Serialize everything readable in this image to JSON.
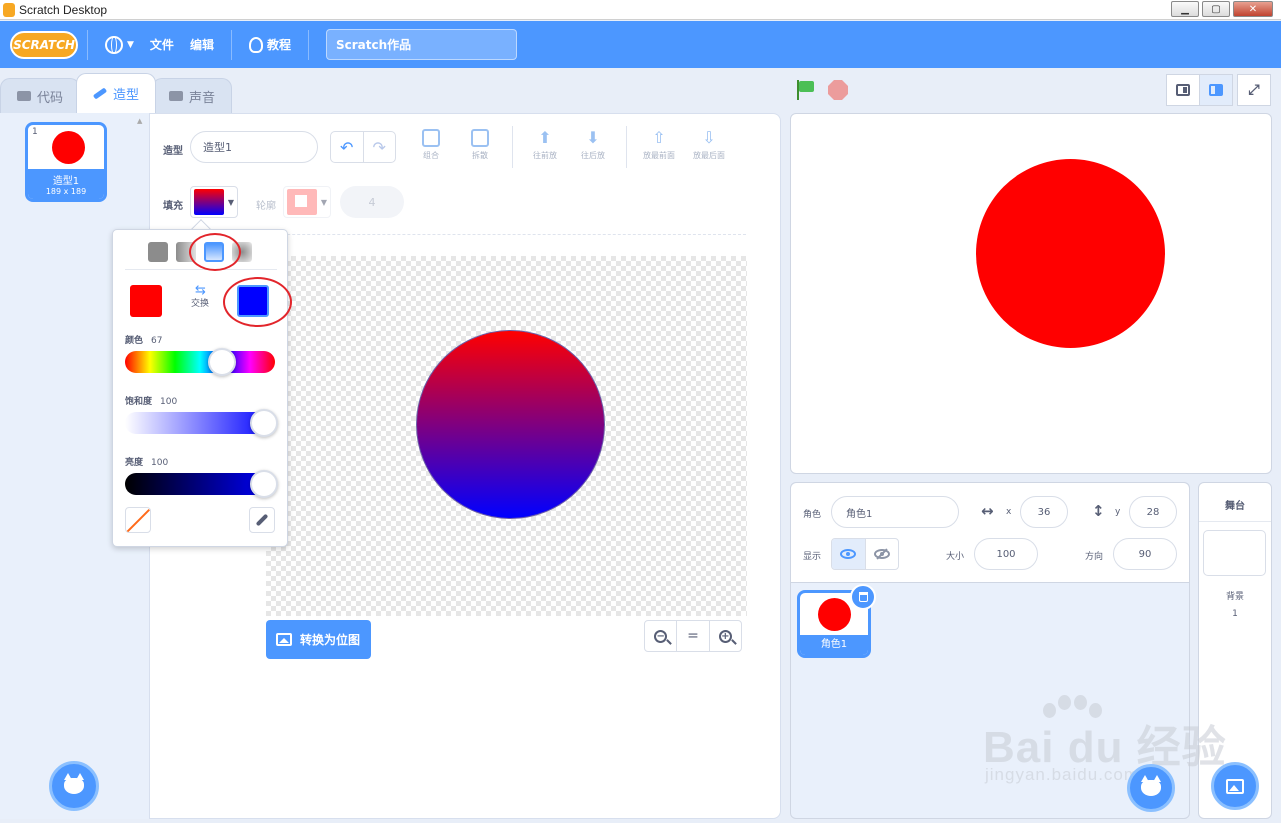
{
  "window": {
    "title": "Scratch Desktop",
    "minimize": "▁",
    "maximize": "▢",
    "close": "✕"
  },
  "menu": {
    "logo": "SCRATCH",
    "file": "文件",
    "edit": "编辑",
    "tutorials": "教程",
    "project_title": "Scratch作品"
  },
  "tabs": {
    "code": "代码",
    "costumes": "造型",
    "sounds": "声音"
  },
  "costumes": [
    {
      "index": "1",
      "name": "造型1",
      "size": "189 x 189"
    }
  ],
  "paint_editor": {
    "costume_label": "造型",
    "costume_name": "造型1",
    "undo": "↶",
    "redo": "↷",
    "group": "组合",
    "ungroup": "拆散",
    "forward": "往前放",
    "backward": "往后放",
    "front": "放最前面",
    "back": "放最后面",
    "fill_label": "填充",
    "outline_label": "轮廓",
    "outline_width": "4",
    "convert_label": "转换为位图",
    "zoom_out": "−",
    "zoom_reset": "=",
    "zoom_in": "+"
  },
  "color_picker": {
    "swap_label": "交换",
    "swap_arrows": "⇆",
    "color1": "#ff0000",
    "color2": "#0000ff",
    "hue_label": "颜色",
    "hue_value": "67",
    "hue": 67,
    "saturation_label": "饱和度",
    "saturation_value": "100",
    "saturation": 100,
    "brightness_label": "亮度",
    "brightness_value": "100",
    "brightness": 100,
    "selected_mode": "vertical-gradient"
  },
  "stage_controls": {
    "fullscreen": "⤢"
  },
  "sprite_info": {
    "sprite_label": "角色",
    "sprite_name": "角色1",
    "x_icon": "↔",
    "x_label": "x",
    "x_value": "36",
    "y_icon": "↕",
    "y_label": "y",
    "y_value": "28",
    "show_label": "显示",
    "size_label": "大小",
    "size_value": "100",
    "direction_label": "方向",
    "direction_value": "90"
  },
  "sprites": [
    {
      "name": "角色1"
    }
  ],
  "stage_pane": {
    "title": "舞台",
    "backdrop_label": "背景",
    "backdrop_count": "1"
  },
  "watermark": {
    "brand": "Bai du 经验",
    "url": "jingyan.baidu.com"
  },
  "colors": {
    "accent": "#4c97ff",
    "sprite_red": "#ff0000",
    "annotation_red": "#e2252b"
  }
}
